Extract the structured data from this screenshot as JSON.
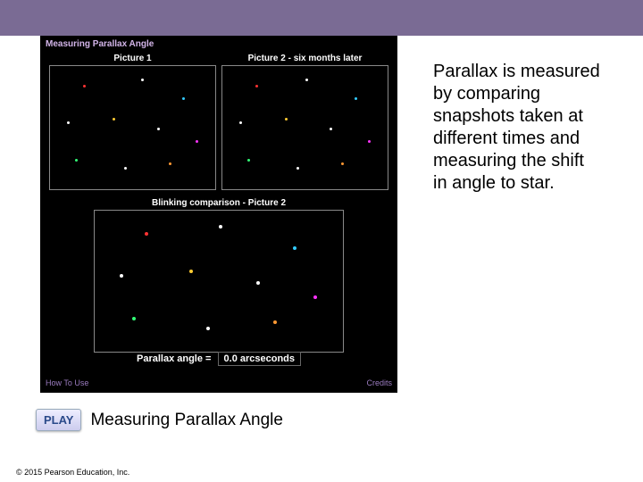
{
  "app": {
    "title": "Measuring Parallax Angle",
    "panel1_title": "Picture 1",
    "panel2_title": "Picture 2 - six months later",
    "bottom_title": "Blinking comparison - Picture 2",
    "angle_label": "Parallax angle =",
    "angle_value": "0.0 arcseconds",
    "howto": "How To Use",
    "credits": "Credits"
  },
  "description": "Parallax is measured by comparing snapshots taken at different times and measuring the shift in angle to star.",
  "play": {
    "button": "PLAY",
    "label": "Measuring Parallax Angle"
  },
  "copyright": "© 2015 Pearson Education, Inc."
}
